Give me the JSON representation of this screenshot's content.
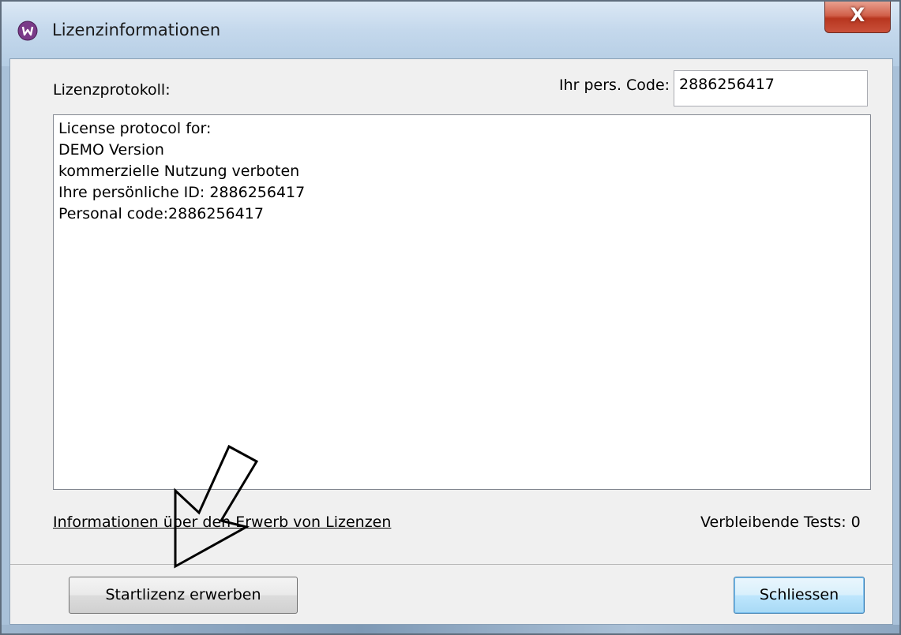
{
  "window": {
    "title": "Lizenzinformationen",
    "close_glyph": "X",
    "app_icon": "app-logo-icon"
  },
  "form": {
    "protocol_label": "Lizenzprotokoll:",
    "code_label": "Ihr pers. Code:",
    "code_value": "2886256417",
    "protocol_lines": [
      "License protocol for:",
      "DEMO Version",
      "kommerzielle Nutzung verboten",
      "Ihre persönliche ID: 2886256417",
      "Personal code:2886256417"
    ],
    "info_link": "Informationen über den Erwerb von Lizenzen",
    "remaining_tests": "Verbleibende Tests: 0"
  },
  "buttons": {
    "start_license": "Startlizenz erwerben",
    "close": "Schliessen"
  },
  "annotation": {
    "icon": "arrow-pointer-annotation",
    "color": "#000000"
  },
  "colors": {
    "titlebar": "#c4d8ec",
    "client_bg": "#f0f0f0",
    "close_button": "#c9503a",
    "default_button_border": "#3c7fb1"
  }
}
